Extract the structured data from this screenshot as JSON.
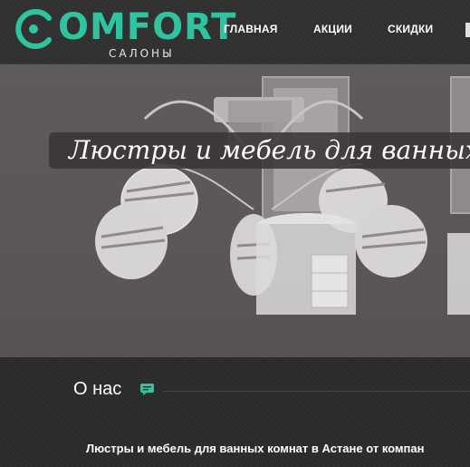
{
  "logo": {
    "word": "OMFORT",
    "subtitle": "САЛОНЫ",
    "accent": "#2fc39f"
  },
  "nav": [
    "ГЛАВНАЯ",
    "АКЦИИ",
    "СКИДКИ"
  ],
  "hero": {
    "title": "Люстры и мебель для ванных к"
  },
  "about": {
    "title": "О нас",
    "icon": "chat-icon",
    "intro": "Люстры и мебель для ванных комнат в Астане от компан"
  }
}
